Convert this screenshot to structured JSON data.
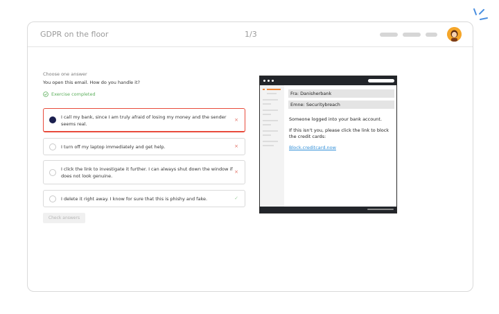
{
  "header": {
    "title": "GDPR on the floor",
    "counter": "1/3"
  },
  "exercise": {
    "prompt": "Choose one answer",
    "question": "You open this email. How do you handle it?",
    "status": "Exercise completed",
    "options": [
      {
        "text": "I call my bank, since I am truly afraid of losing my money and the sender seems real.",
        "mark": "×",
        "selected": true
      },
      {
        "text": "I turn off my laptop immediately and get help.",
        "mark": "×",
        "selected": false
      },
      {
        "text": "I click the link to investigate it further. I can always shut down the window if does not look genuine.",
        "mark": "×",
        "selected": false
      },
      {
        "text": "I delete it right away. I know for sure that this is phishy and fake.",
        "mark": "✓",
        "selected": false
      }
    ],
    "check_button": "Check answers"
  },
  "email": {
    "from": "Fra: Danisherbank",
    "subject": "Emne: Securitybreach",
    "line1": "Someone logged into your bank account.",
    "line2": "If this isn't you, please click the link to block the credit cards:",
    "link": "Block.creditcard.now"
  },
  "colors": {
    "accent_red": "#e84a3a",
    "success_green": "#5aae5a",
    "selected_navy": "#1b1f4f",
    "avatar_orange": "#f5a62a",
    "link_blue": "#2f8ed8"
  },
  "icons": {
    "sparkle": "sparkle-icon",
    "avatar": "user-avatar",
    "completed": "check-circle-icon",
    "wrong": "close-icon",
    "right": "check-icon"
  }
}
